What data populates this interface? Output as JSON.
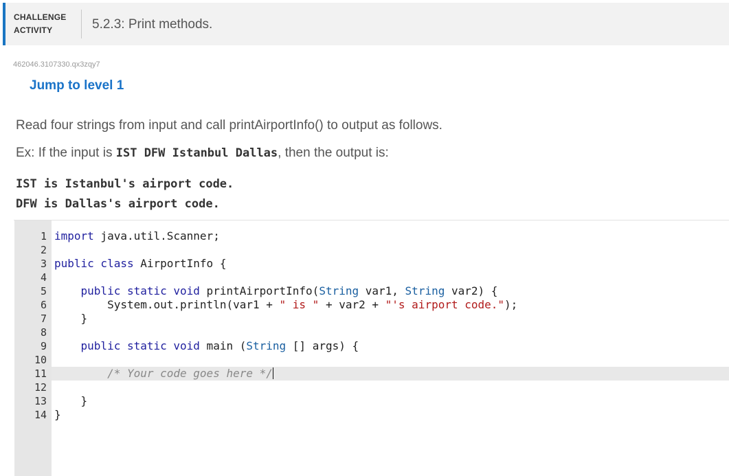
{
  "header": {
    "badge_line1": "CHALLENGE",
    "badge_line2": "ACTIVITY",
    "title": "5.2.3: Print methods."
  },
  "activity_id": "462046.3107330.qx3zqy7",
  "jump_link": "Jump to level 1",
  "instructions": {
    "prompt": "Read four strings from input and call printAirportInfo() to output as follows.",
    "example_prefix": "Ex: If the input is ",
    "example_input": "IST DFW Istanbul Dallas",
    "example_suffix": ", then the output is:",
    "output_lines": [
      "IST is Istanbul's airport code.",
      "DFW is Dallas's airport code."
    ]
  },
  "editor": {
    "active_line": 11,
    "lines": [
      {
        "n": "1",
        "tokens": [
          {
            "c": "kw",
            "t": "import"
          },
          {
            "c": "",
            "t": " java.util.Scanner;"
          }
        ]
      },
      {
        "n": "2",
        "tokens": []
      },
      {
        "n": "3",
        "tokens": [
          {
            "c": "kw",
            "t": "public class"
          },
          {
            "c": "",
            "t": " AirportInfo {"
          }
        ]
      },
      {
        "n": "4",
        "tokens": []
      },
      {
        "n": "5",
        "tokens": [
          {
            "c": "",
            "t": "    "
          },
          {
            "c": "kw",
            "t": "public static void"
          },
          {
            "c": "",
            "t": " printAirportInfo("
          },
          {
            "c": "ty",
            "t": "String"
          },
          {
            "c": "",
            "t": " var1, "
          },
          {
            "c": "ty",
            "t": "String"
          },
          {
            "c": "",
            "t": " var2) {"
          }
        ]
      },
      {
        "n": "6",
        "tokens": [
          {
            "c": "",
            "t": "        System.out.println(var1 + "
          },
          {
            "c": "st",
            "t": "\" is \""
          },
          {
            "c": "",
            "t": " + var2 + "
          },
          {
            "c": "st",
            "t": "\"'s airport code.\""
          },
          {
            "c": "",
            "t": ");"
          }
        ]
      },
      {
        "n": "7",
        "tokens": [
          {
            "c": "",
            "t": "    }"
          }
        ]
      },
      {
        "n": "8",
        "tokens": []
      },
      {
        "n": "9",
        "tokens": [
          {
            "c": "",
            "t": "    "
          },
          {
            "c": "kw",
            "t": "public static void"
          },
          {
            "c": "",
            "t": " main ("
          },
          {
            "c": "ty",
            "t": "String"
          },
          {
            "c": "",
            "t": " [] args) {"
          }
        ]
      },
      {
        "n": "10",
        "tokens": []
      },
      {
        "n": "11",
        "tokens": [
          {
            "c": "",
            "t": "        "
          },
          {
            "c": "cm",
            "t": "/* Your code goes here */"
          }
        ]
      },
      {
        "n": "12",
        "tokens": []
      },
      {
        "n": "13",
        "tokens": [
          {
            "c": "",
            "t": "    }"
          }
        ]
      },
      {
        "n": "14",
        "tokens": [
          {
            "c": "",
            "t": "}"
          }
        ]
      }
    ]
  }
}
